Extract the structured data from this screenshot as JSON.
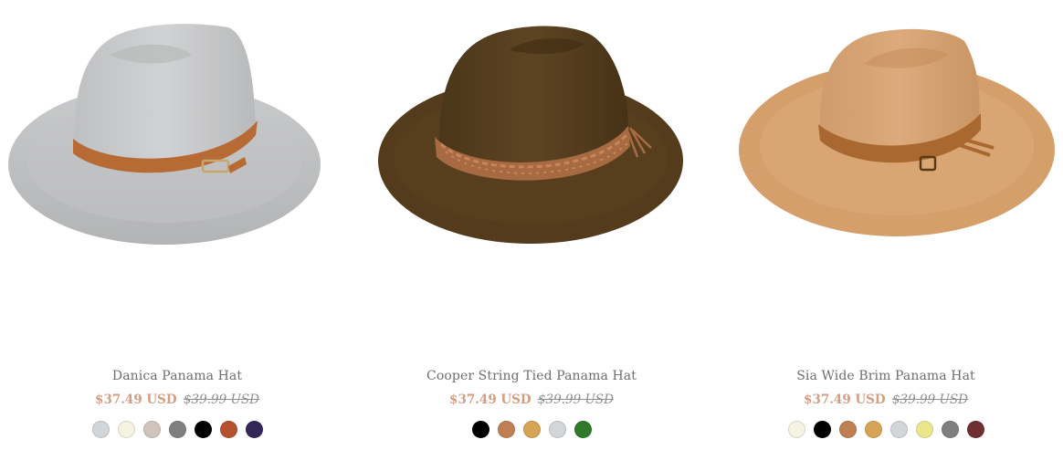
{
  "products": [
    {
      "title": "Danica Panama Hat",
      "price": "$37.49 USD",
      "compare_price": "$39.99 USD",
      "image_icon": "grey-panama-hat-with-brown-belt-band",
      "swatches": [
        "#d3d6d9",
        "#f6f3e2",
        "#cfc5bc",
        "#7f7f7f",
        "#000000",
        "#b5512d",
        "#33275a"
      ]
    },
    {
      "title": "Cooper String Tied Panama Hat",
      "price": "$37.49 USD",
      "compare_price": "$39.99 USD",
      "image_icon": "brown-panama-hat-with-macrame-band",
      "swatches": [
        "#000000",
        "#c07f53",
        "#d6a455",
        "#d3d6d9",
        "#2e7a28"
      ]
    },
    {
      "title": "Sia Wide Brim Panama Hat",
      "price": "$37.49 USD",
      "compare_price": "$39.99 USD",
      "image_icon": "camel-wide-brim-panama-hat-with-buckle-band",
      "swatches": [
        "#f6f3e2",
        "#000000",
        "#c07f53",
        "#d6a455",
        "#d3d6d9",
        "#ece68a",
        "#7f7f7f",
        "#6e3030"
      ]
    }
  ]
}
